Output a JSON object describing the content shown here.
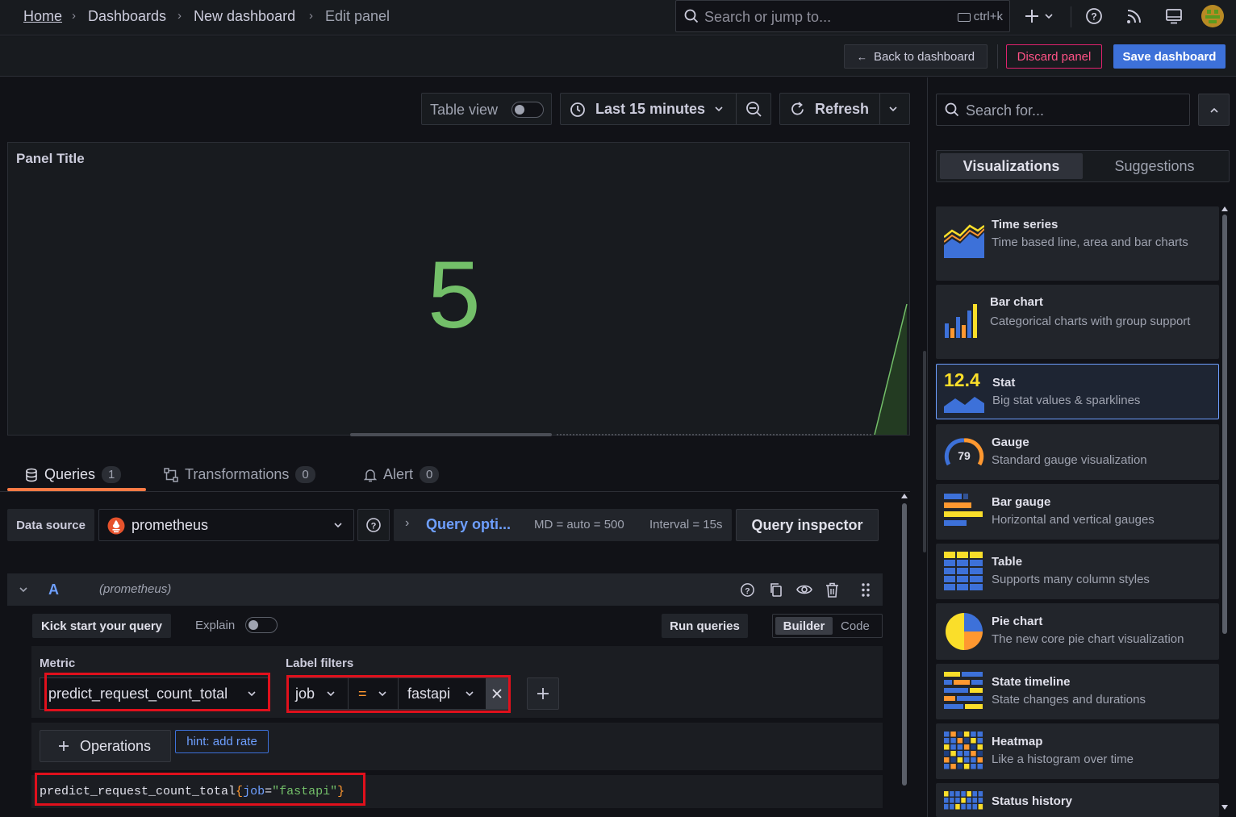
{
  "breadcrumb": {
    "home": "Home",
    "dashboards": "Dashboards",
    "new_dashboard": "New dashboard",
    "edit_panel": "Edit panel"
  },
  "search": {
    "placeholder": "Search or jump to...",
    "shortcut": "ctrl+k"
  },
  "toolbar": {
    "back": "Back to dashboard",
    "discard": "Discard panel",
    "save": "Save dashboard"
  },
  "panel_controls": {
    "table_view": "Table view",
    "time_range": "Last 15 minutes",
    "refresh": "Refresh"
  },
  "panel": {
    "title": "Panel Title",
    "value": "5"
  },
  "tabs": [
    {
      "label": "Queries",
      "count": "1"
    },
    {
      "label": "Transformations",
      "count": "0"
    },
    {
      "label": "Alert",
      "count": "0"
    }
  ],
  "datasource": {
    "label": "Data source",
    "value": "prometheus",
    "query_options": "Query opti...",
    "md": "MD = auto = 500",
    "interval": "Interval = 15s",
    "inspector": "Query inspector"
  },
  "query": {
    "ref": "A",
    "source": "(prometheus)",
    "kickstart": "Kick start your query",
    "explain": "Explain",
    "run": "Run queries",
    "builder": "Builder",
    "code_tab": "Code",
    "metric_label": "Metric",
    "metric": "predict_request_count_total",
    "label_filters": "Label filters",
    "filter": {
      "key": "job",
      "op": "=",
      "value": "fastapi"
    },
    "operations": "Operations",
    "hint": "hint: add rate",
    "preview": {
      "metric": "predict_request_count_total",
      "open": "{",
      "key": "job",
      "eq": "=",
      "val": "\"fastapi\"",
      "close": "}"
    }
  },
  "sidebar": {
    "search_placeholder": "Search for...",
    "tab_vis": "Visualizations",
    "tab_sugg": "Suggestions",
    "items": [
      {
        "name": "Time series",
        "desc": "Time based line, area and bar charts"
      },
      {
        "name": "Bar chart",
        "desc": "Categorical charts with group support"
      },
      {
        "name": "Stat",
        "desc": "Big stat values & sparklines",
        "icon_text": "12.4"
      },
      {
        "name": "Gauge",
        "desc": "Standard gauge visualization",
        "icon_text": "79"
      },
      {
        "name": "Bar gauge",
        "desc": "Horizontal and vertical gauges"
      },
      {
        "name": "Table",
        "desc": "Supports many column styles"
      },
      {
        "name": "Pie chart",
        "desc": "The new core pie chart visualization"
      },
      {
        "name": "State timeline",
        "desc": "State changes and durations"
      },
      {
        "name": "Heatmap",
        "desc": "Like a histogram over time"
      },
      {
        "name": "Status history",
        "desc": ""
      }
    ]
  },
  "colors": {
    "accent": "#3d71d9",
    "stat_green": "#73bf69",
    "danger": "#e0226e",
    "highlight": "#e0101c"
  }
}
